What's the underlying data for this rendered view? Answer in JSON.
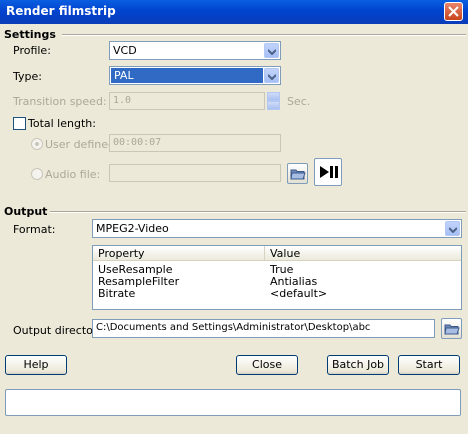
{
  "window": {
    "title": "Render filmstrip"
  },
  "settings": {
    "section_label": "Settings",
    "profile": {
      "label": "Profile:",
      "value": "VCD"
    },
    "type": {
      "label": "Type:",
      "value": "PAL"
    },
    "transition_speed": {
      "label": "Transition speed:",
      "value": "1.0",
      "unit": "Sec."
    },
    "total_length": {
      "label": "Total length:",
      "checked": false
    },
    "user_defined": {
      "label": "User defined:",
      "value": "00:00:07"
    },
    "audio_file": {
      "label": "Audio file:",
      "value": ""
    }
  },
  "output": {
    "section_label": "Output",
    "format": {
      "label": "Format:",
      "value": "MPEG2-Video"
    },
    "properties": {
      "columns": [
        "Property",
        "Value"
      ],
      "rows": [
        {
          "property": "UseResample",
          "value": "True"
        },
        {
          "property": "ResampleFilter",
          "value": "Antialias"
        },
        {
          "property": "Bitrate",
          "value": "<default>"
        }
      ]
    },
    "directory": {
      "label": "Output directory:",
      "value": "C:\\Documents and Settings\\Administrator\\Desktop\\abc"
    }
  },
  "buttons": {
    "help": "Help",
    "close": "Close",
    "batch_job": "Batch Job",
    "start": "Start"
  },
  "icons": {
    "close": "close-icon",
    "folder": "folder-icon",
    "play_pause": "play-pause-icon"
  },
  "colors": {
    "title_bar": "#0a5fe0",
    "selection": "#316ac5",
    "background": "#ece9d8"
  }
}
